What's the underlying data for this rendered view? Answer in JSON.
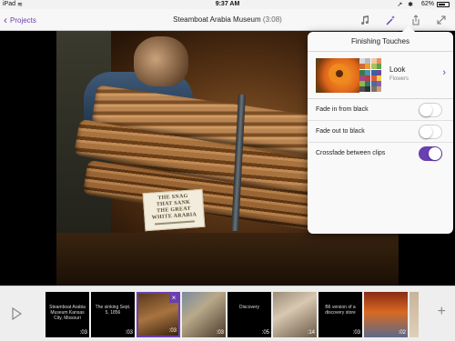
{
  "status_bar": {
    "carrier": "iPad",
    "time": "9:37 AM",
    "battery": "62%"
  },
  "nav": {
    "back_label": "Projects",
    "title": "Steamboat Arabia Museum",
    "duration": "(3:08)",
    "icons": [
      "music-note-icon",
      "magic-wand-icon",
      "share-icon",
      "fullscreen-icon"
    ]
  },
  "viewer": {
    "sign_text": [
      "THE SNAG",
      "THAT SANK",
      "THE GREAT",
      "WHITE ARABIA"
    ]
  },
  "finishing_touches": {
    "title": "Finishing Touches",
    "look_label": "Look",
    "look_value": "Flowers",
    "toggles": [
      {
        "label": "Fade in from black",
        "on": false
      },
      {
        "label": "Fade out to black",
        "on": false
      },
      {
        "label": "Crossfade between clips",
        "on": true
      }
    ],
    "accent": "#6a3fb0"
  },
  "timeline": {
    "clips": [
      {
        "title": "Steamboat Arabia Museum Kansas City, Missouri",
        "duration": ":03",
        "kind": "title"
      },
      {
        "title": "The sinking Sept. 5, 1856",
        "duration": ":03",
        "kind": "title"
      },
      {
        "title": "",
        "duration": ":03",
        "kind": "photo-a",
        "selected": true
      },
      {
        "title": "",
        "duration": ":03",
        "kind": "photo-b"
      },
      {
        "title": "Discovery",
        "duration": ":05",
        "kind": "title"
      },
      {
        "title": "",
        "duration": ":14",
        "kind": "photo-c"
      },
      {
        "title": "B6 version of a discovery store",
        "duration": ":03",
        "kind": "title"
      },
      {
        "title": "",
        "duration": ":02",
        "kind": "photo-e"
      }
    ]
  }
}
